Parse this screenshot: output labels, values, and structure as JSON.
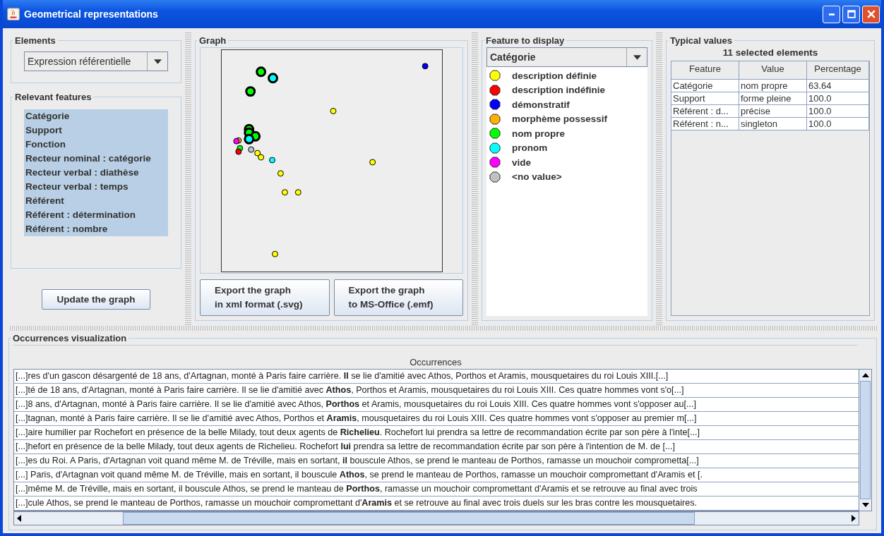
{
  "window": {
    "title": "Geometrical representations"
  },
  "elements": {
    "title": "Elements",
    "value": "Expression référentielle"
  },
  "relevant_features": {
    "title": "Relevant features",
    "items": [
      {
        "label": "Catégorie",
        "selected": true
      },
      {
        "label": "Support",
        "selected": true
      },
      {
        "label": "Fonction",
        "selected": true
      },
      {
        "label": "Recteur nominal : catégorie",
        "selected": true
      },
      {
        "label": "Recteur verbal : diathèse",
        "selected": true
      },
      {
        "label": "Recteur verbal : temps",
        "selected": true
      },
      {
        "label": "Référent",
        "selected": true
      },
      {
        "label": "Référent : détermination",
        "selected": true
      },
      {
        "label": "Référent : nombre",
        "selected": true
      }
    ]
  },
  "update_button": "Update the graph",
  "graph": {
    "title": "Graph",
    "buttons": [
      [
        "Export the graph",
        "in xml format (.svg)"
      ],
      [
        "Export the graph",
        "to MS-Office (.emf)"
      ]
    ]
  },
  "feature_to_display": {
    "title": "Feature to display",
    "value": "Catégorie",
    "legend": [
      {
        "label": "description définie",
        "color": "#ffff00"
      },
      {
        "label": "description indéfinie",
        "color": "#ff0000"
      },
      {
        "label": "démonstratif",
        "color": "#0000ff"
      },
      {
        "label": "morphème possessif",
        "color": "#ffb000"
      },
      {
        "label": "nom propre",
        "color": "#00ff00"
      },
      {
        "label": "pronom",
        "color": "#00ffff"
      },
      {
        "label": "vide",
        "color": "#ff00ff"
      },
      {
        "label": "<no value>",
        "color": "#c0c0c0"
      }
    ]
  },
  "typical_values": {
    "title": "Typical values",
    "caption": "11 selected elements",
    "columns": [
      "Feature",
      "Value",
      "Percentage"
    ],
    "rows": [
      [
        "Catégorie",
        "nom propre",
        "63.64"
      ],
      [
        "Support",
        "forme pleine",
        "100.0"
      ],
      [
        "Référent : d...",
        "précise",
        "100.0"
      ],
      [
        "Référent : n...",
        "singleton",
        "100.0"
      ]
    ]
  },
  "occurrences": {
    "title": "Occurrences visualization",
    "column": "Occurrences",
    "rows": [
      "[...]res d'un gascon désargenté de 18 ans, d'Artagnan, monté à Paris faire carrière. **Il** se lie d'amitié avec Athos, Porthos et Aramis, mousquetaires du roi Louis XIII.[...]",
      "[...]té de 18 ans, d'Artagnan, monté à Paris faire carrière. Il se lie d'amitié avec **Athos**, Porthos et Aramis, mousquetaires du roi Louis XIII. Ces quatre hommes vont s'o[...]",
      "[...]8 ans, d'Artagnan, monté à Paris faire carrière. Il se lie d'amitié avec Athos, **Porthos** et Aramis, mousquetaires du roi Louis XIII. Ces quatre hommes vont s'opposer au[...]",
      "[...]tagnan, monté à Paris faire carrière. Il se lie d'amitié avec Athos, Porthos et **Aramis**, mousquetaires du roi Louis XIII. Ces quatre hommes vont s'opposer au premier m[...]",
      "[...]aire humilier par Rochefort en présence de la belle Milady, tout deux agents de **Richelieu**. Rochefort lui prendra sa lettre de recommandation écrite par son père à l'inte[...]",
      "[...]hefort en présence de la belle Milady, tout deux agents de Richelieu. Rochefort **lui** prendra sa lettre de recommandation écrite par son père à l'intention de M. de [...]",
      "[...]es du Roi. A Paris, d'Artagnan voit quand même M. de Tréville, mais en sortant, **il** bouscule Athos, se prend le manteau de Porthos, ramasse un mouchoir comprometta[...]",
      "[...] Paris, d'Artagnan voit quand même M. de Tréville, mais en sortant, il bouscule **Athos**, se prend le manteau de Porthos, ramasse un mouchoir compromettant d'Aramis et [.",
      "[...]même M. de Tréville, mais en sortant, il bouscule Athos, se prend le manteau de **Porthos**, ramasse un mouchoir compromettant d'Aramis et se retrouve au final avec trois",
      "[...]cule Athos, se prend le manteau de Porthos, ramasse un mouchoir compromettant d'**Aramis** et se retrouve au final avec trois duels sur les bras contre les mousquetaires."
    ]
  }
}
